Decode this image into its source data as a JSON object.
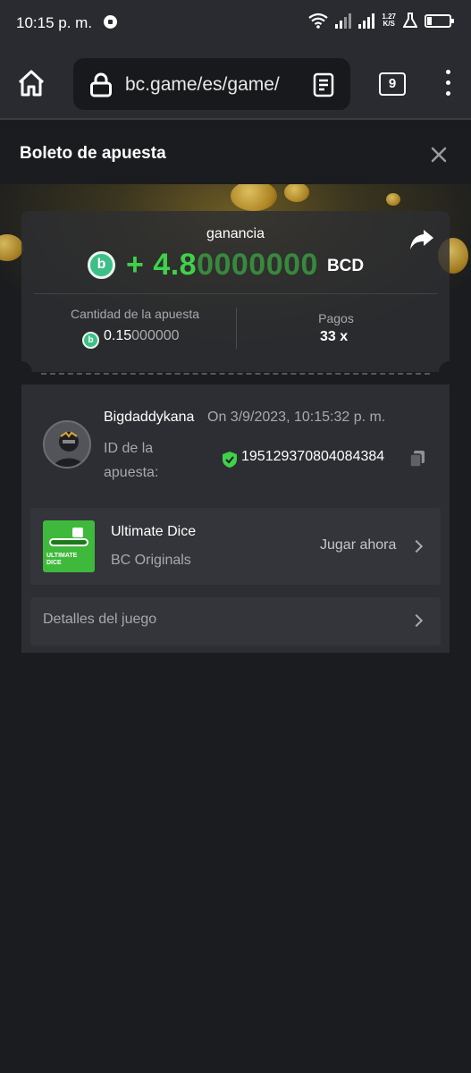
{
  "status_bar": {
    "time": "10:15 p. m.",
    "net_speed_value": "1.27",
    "net_speed_unit": "K/S"
  },
  "browser": {
    "url": "bc.game/es/game/",
    "tab_count": "9"
  },
  "sheet": {
    "title": "Boleto de apuesta"
  },
  "bet": {
    "win_label": "ganancia",
    "win_sign": "+",
    "win_amount_main": "4.8",
    "win_amount_trailing": "0000000",
    "currency": "BCD",
    "coin_glyph": "b",
    "stake_label": "Cantidad de la apuesta",
    "stake_main": "0.15",
    "stake_trailing": "000000",
    "payout_label": "Pagos",
    "payout_value": "33 x"
  },
  "player": {
    "username": "Bigdaddykana",
    "datetime": "On 3/9/2023, 10:15:32 p. m.",
    "bet_id_label": "ID de la apuesta:",
    "bet_id": "195129370804084384"
  },
  "game": {
    "name": "Ultimate Dice",
    "provider": "BC Originals",
    "play_label": "Jugar ahora",
    "thumb_text_line1": "ULTIMATE",
    "thumb_text_line2": "DICE"
  },
  "details": {
    "label": "Detalles del juego"
  },
  "colors": {
    "win_green": "#3fd14a",
    "coin_green": "#3dbf87",
    "background": "#1b1c1f",
    "card": "#2d2e33"
  }
}
